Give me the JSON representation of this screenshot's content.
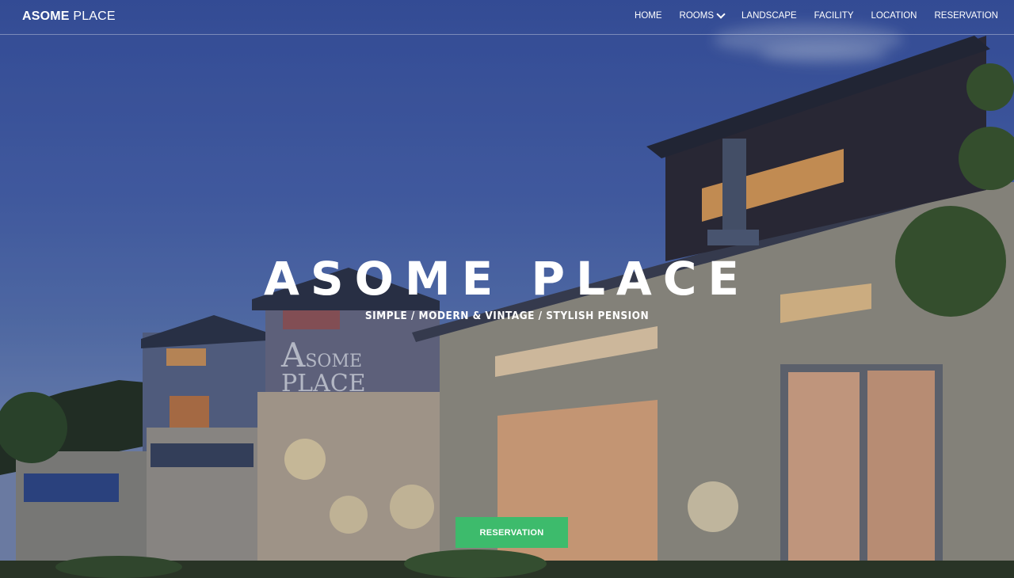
{
  "brand": {
    "bold": "ASOME",
    "light": "PLACE"
  },
  "nav": {
    "items": [
      {
        "label": "HOME"
      },
      {
        "label": "ROOMS",
        "dropdown": true
      },
      {
        "label": "LANDSCAPE"
      },
      {
        "label": "FACILITY"
      },
      {
        "label": "LOCATION"
      },
      {
        "label": "RESERVATION"
      }
    ]
  },
  "hero": {
    "title": "ASOME PLACE",
    "subtitle": "SIMPLE / MODERN & VINTAGE / STYLISH PENSION",
    "sign_line1": "SOME",
    "sign_line2": "PLACE",
    "sign_initial": "A",
    "cta_label": "RESERVATION"
  },
  "colors": {
    "cta": "#3dbb6c",
    "sky": "#3a56a8"
  }
}
